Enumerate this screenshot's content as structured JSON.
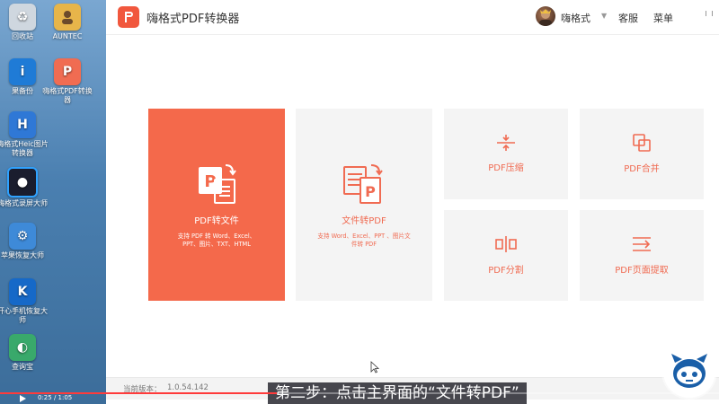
{
  "desktop": {
    "icons": [
      {
        "label": "回收站",
        "glyph": "♻",
        "icon": "recycle-bin-icon"
      },
      {
        "label": "AUNTEC",
        "glyph": "",
        "icon": "user-folder-icon"
      },
      {
        "label": "果备份",
        "glyph": "i",
        "icon": "backup-app-icon"
      },
      {
        "label": "嗨格式PDF转换器",
        "glyph": "P",
        "icon": "pdf-converter-app-icon"
      },
      {
        "label": "嗨格式Heic图片转换器",
        "glyph": "H",
        "icon": "heic-converter-app-icon"
      },
      {
        "label": "嗨格式录屏大师",
        "glyph": "●",
        "icon": "screen-recorder-app-icon"
      },
      {
        "label": "苹果恢复大师",
        "glyph": "⚙",
        "icon": "apple-recovery-app-icon"
      },
      {
        "label": "开心手机恢复大师",
        "glyph": "K",
        "icon": "phone-recovery-app-icon"
      },
      {
        "label": "查询宝",
        "glyph": "◐",
        "icon": "query-app-icon"
      }
    ]
  },
  "app": {
    "title": "嗨格式PDF转换器",
    "user_name": "嗨格式",
    "support_label": "客服",
    "menu_label": "菜单",
    "version_label": "当前版本：",
    "version_value": "1.0.54.142",
    "accent_color": "#f4694b"
  },
  "cards": {
    "pdf_to_file": {
      "title": "PDF转文件",
      "desc": "支持 PDF 转 Word、Excel、\nPPT、图片、TXT、HTML"
    },
    "file_to_pdf": {
      "title": "文件转PDF",
      "desc": "支持 Word、Excel、PPT 、图片文\n件转 PDF"
    },
    "compress": {
      "title": "PDF压缩"
    },
    "merge": {
      "title": "PDF合并"
    },
    "split": {
      "title": "PDF分割"
    },
    "extract": {
      "title": "PDF页面提取"
    }
  },
  "video": {
    "time": "0:25 / 1:05",
    "progress": 0.385,
    "subtitle": "第二步：点击主界面的“文件转PDF”"
  }
}
